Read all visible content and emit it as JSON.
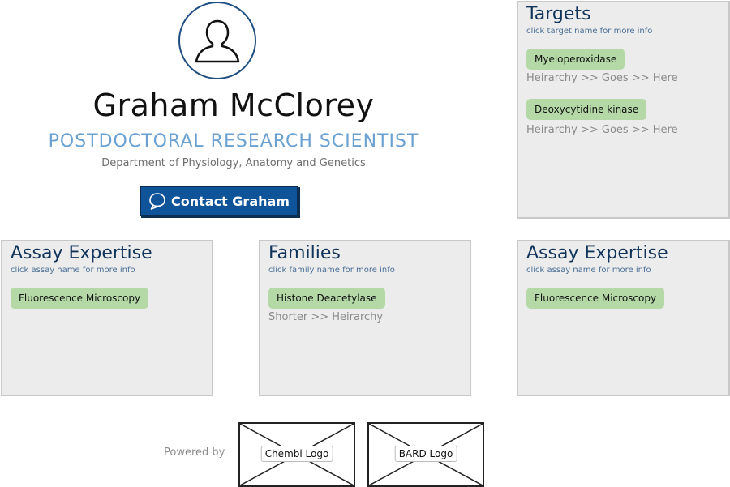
{
  "profile": {
    "name": "Graham McClorey",
    "title": "POSTDOCTORAL RESEARCH SCIENTIST",
    "department": "Department of Physiology, Anatomy and Genetics",
    "contact_label": "Contact Graham",
    "avatar_icon": "user-icon",
    "contact_icon": "speech-bubble-icon"
  },
  "targets": {
    "title": "Targets",
    "hint": "click target name for more info",
    "items": [
      {
        "label": "Myeloperoxidase",
        "hierarchy": "Heirarchy >> Goes >> Here"
      },
      {
        "label": "Deoxycytidine kinase",
        "hierarchy": "Heirarchy >> Goes >> Here"
      }
    ]
  },
  "assay_left": {
    "title": "Assay Expertise",
    "hint": "click assay name for more info",
    "items": [
      {
        "label": "Fluorescence Microscopy"
      }
    ]
  },
  "families": {
    "title": "Families",
    "hint": "click family name for more info",
    "items": [
      {
        "label": "Histone Deacetylase",
        "hierarchy": "Shorter >> Heirarchy"
      }
    ]
  },
  "assay_right": {
    "title": "Assay Expertise",
    "hint": "click assay name for more info",
    "items": [
      {
        "label": "Fluorescence Microscopy"
      }
    ]
  },
  "footer": {
    "powered_by": "Powered by",
    "logos": [
      {
        "label": "Chembl Logo"
      },
      {
        "label": "BARD Logo"
      }
    ]
  },
  "colors": {
    "accent_blue": "#0f5499",
    "title_blue": "#6aa1d1",
    "chip_green": "#b4d9a6",
    "panel_bg": "#ececec"
  }
}
